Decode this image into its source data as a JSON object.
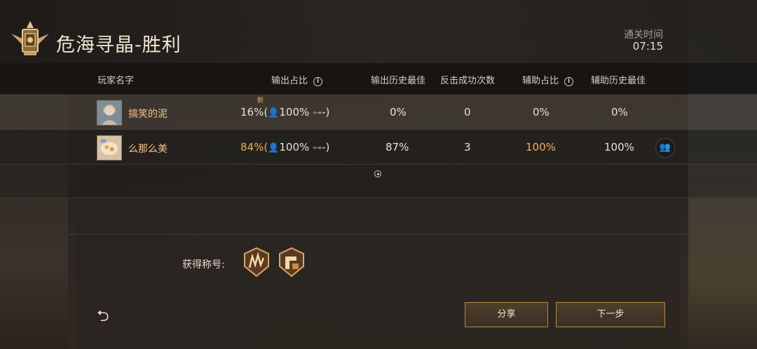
{
  "header": {
    "title": "危海寻晶-胜利",
    "time_label": "通关时间",
    "time_value": "07:15"
  },
  "columns": {
    "player_name": "玩家名字",
    "output_ratio": "输出占比",
    "output_best": "输出历史最佳",
    "counter_count": "反击成功次数",
    "assist_ratio": "辅助占比",
    "assist_best": "辅助历史最佳"
  },
  "players": [
    {
      "name": "搞笑的泥",
      "new_tag": "新",
      "output_pct": "16%(",
      "output_player": "100%",
      "output_drone": "-)",
      "output_best": "0%",
      "counter": "0",
      "assist": "0%",
      "assist_best": "0%"
    },
    {
      "name": "么那么美",
      "output_pct": "84%(",
      "output_player": "100%",
      "output_drone": "-)",
      "output_best": "87%",
      "counter": "3",
      "assist": "100%",
      "assist_best": "100%"
    }
  ],
  "footer": {
    "titles_label": "获得称号:",
    "share_label": "分享",
    "next_label": "下一步"
  },
  "colors": {
    "accent_gold": "#f0b050",
    "name_color": "#f0c48a",
    "button_border": "#b48a45"
  }
}
